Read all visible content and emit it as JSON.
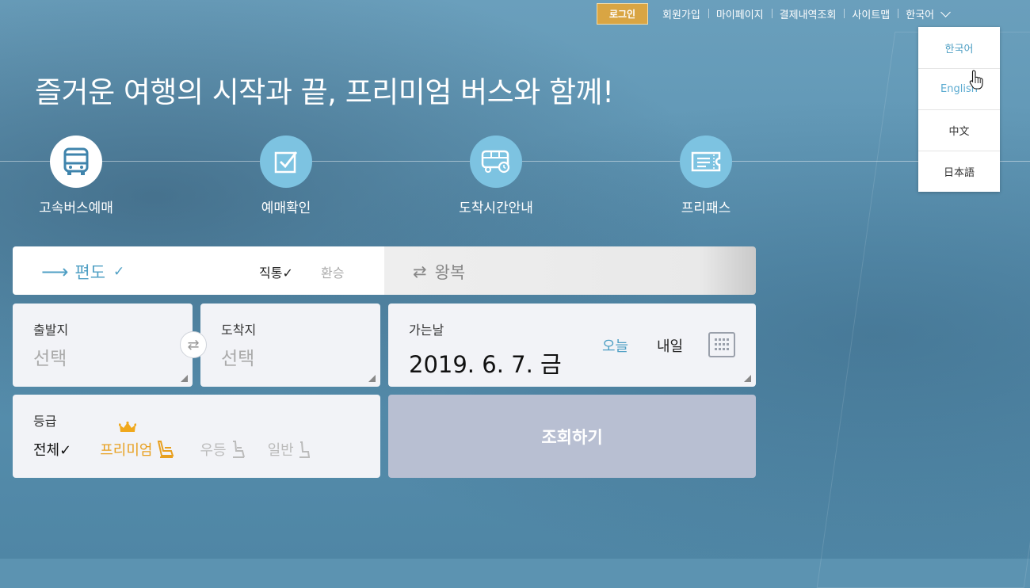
{
  "topnav": {
    "login": "로그인",
    "links": [
      "회원가입",
      "마이페이지",
      "결제내역조회",
      "사이트맵"
    ],
    "language_current": "한국어"
  },
  "language_menu": {
    "items": [
      "한국어",
      "English",
      "中文",
      "日本語"
    ],
    "active": "한국어"
  },
  "headline": "즐거운 여행의 시작과 끝, 프리미엄 버스와 함께!",
  "menu": {
    "items": [
      {
        "label": "고속버스예매",
        "icon": "bus-icon"
      },
      {
        "label": "예매확인",
        "icon": "checkbox-icon"
      },
      {
        "label": "도착시간안내",
        "icon": "bus-clock-icon"
      },
      {
        "label": "프리패스",
        "icon": "ticket-icon"
      }
    ]
  },
  "trip": {
    "oneway": "편도",
    "direct": "직통",
    "transfer": "환승",
    "roundtrip": "왕복"
  },
  "departure": {
    "label": "출발지",
    "value": "선택"
  },
  "arrival": {
    "label": "도착지",
    "value": "선택"
  },
  "date": {
    "label": "가는날",
    "value": "2019. 6. 7. 금",
    "today": "오늘",
    "tomorrow": "내일"
  },
  "grade": {
    "label": "등급",
    "all": "전체",
    "premium": "프리미엄",
    "deluxe": "우등",
    "normal": "일반"
  },
  "search_button": "조회하기",
  "colors": {
    "accent_blue": "#4f9fc4",
    "login_gold": "#d9a543",
    "premium_orange": "#e8a020",
    "search_button": "#b8bfd2"
  }
}
